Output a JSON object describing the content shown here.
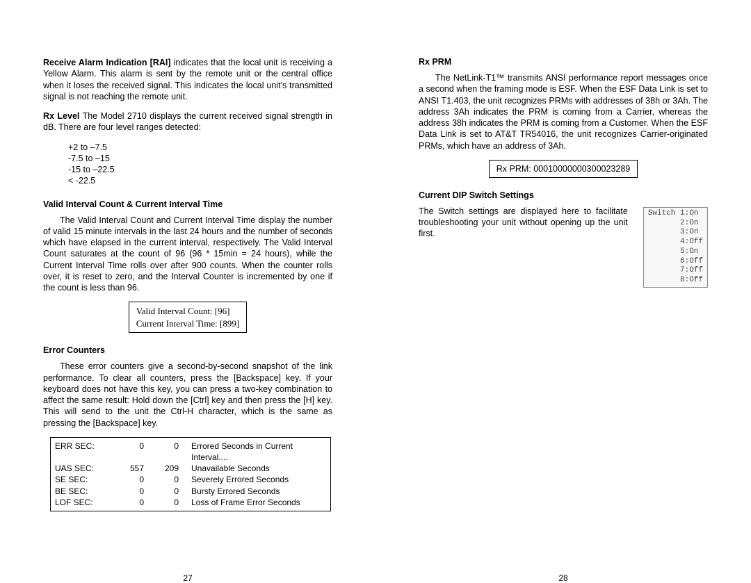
{
  "left": {
    "p1": {
      "runin": "Receive Alarm Indication [RAI]",
      "text": "  indicates that the local unit is receiving a Yellow Alarm. This alarm is sent by the remote unit or the central office when it loses the received signal. This indicates the local unit's transmitted signal is not reaching the remote unit."
    },
    "p2": {
      "runin": "Rx Level",
      "text": "  The Model 2710 displays the current received signal strength in dB. There are four level ranges detected:"
    },
    "levels": [
      "+2 to –7.5",
      "-7.5 to –15",
      "-15 to –22.5",
      "< -22.5"
    ],
    "h1": "Valid Interval Count & Current Interval Time",
    "p3": "The Valid Interval Count and Current Interval Time display the number of valid 15 minute intervals in the last 24 hours and the number of seconds which have elapsed in the current interval, respectively. The Valid Interval Count saturates at the count of 96 (96 * 15min = 24 hours), while the Current Interval Time rolls over after 900 counts. When the counter rolls over, it is reset to zero, and the Interval Counter is incremented by one if the count is less than 96.",
    "box1_l1": "Valid Interval Count:   [96]",
    "box1_l2": "Current Interval Time: [899]",
    "h2": "Error Counters",
    "p4": "These error counters give a second-by-second snapshot of the link performance. To clear all counters, press the [Backspace] key. If your keyboard does not have this key, you can press a two-key combination to affect the same result: Hold down the [Ctrl] key and then press the [H] key. This will send to the unit the Ctrl-H character, which is the same as pressing the [Backspace] key.",
    "errs": [
      {
        "label": "ERR SEC:",
        "v1": "0",
        "v2": "0",
        "desc": "Errored Seconds in Current Interval...."
      },
      {
        "label": "UAS SEC:",
        "v1": "557",
        "v2": "209",
        "desc": "Unavailable Seconds"
      },
      {
        "label": "SE SEC:",
        "v1": "0",
        "v2": "0",
        "desc": "Severely Errored Seconds"
      },
      {
        "label": "BE SEC:",
        "v1": "0",
        "v2": "0",
        "desc": "Bursty Errored Seconds"
      },
      {
        "label": "LOF SEC:",
        "v1": "0",
        "v2": "0",
        "desc": "Loss of Frame Error Seconds"
      }
    ],
    "pagenum": "27"
  },
  "right": {
    "h1": "Rx PRM",
    "p1": "The NetLink-T1™ transmits ANSI performance report messages once a second when the framing mode is ESF. When the ESF Data Link is set to ANSI T1.403, the unit recognizes PRMs with addresses of 38h or 3Ah. The address 3Ah indicates the PRM is coming from a Carrier, whereas the address 38h indicates the PRM is coming from a Customer. When the ESF Data Link is set to AT&T TR54016, the unit recognizes Carrier-originated PRMs, which have an address of 3Ah.",
    "box1": "Rx PRM: 00010000000300023289",
    "h2": "Current DIP Switch Settings",
    "p2": "The Switch settings are displayed here to facilitate troubleshooting your unit without opening up the unit first.",
    "dip": "Switch 1:On\n       2:On\n       3:On\n       4:Off\n       5:On\n       6:Off\n       7:Off\n       8:Off",
    "pagenum": "28"
  }
}
